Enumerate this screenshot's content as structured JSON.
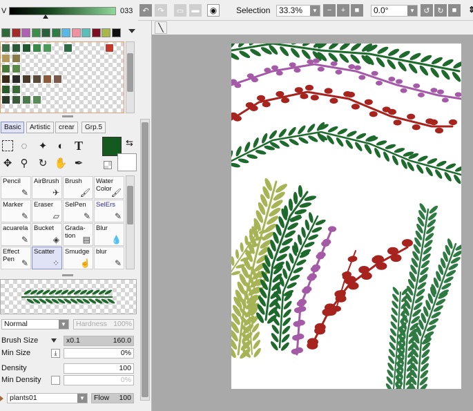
{
  "color_slider": {
    "channel": "V",
    "value": "033"
  },
  "palette_row": [
    "#2c6a3a",
    "#a52a2a",
    "#b060b0",
    "#3e8c4c",
    "#2b5e3e",
    "#2e7d46",
    "#58b8e8",
    "#f090a0",
    "#58c0b8",
    "#7a1020",
    "#a8b848",
    "#101010"
  ],
  "tabs": [
    "Basic",
    "Artistic",
    "crear",
    "Grp.5"
  ],
  "main_color": "#145a1e",
  "brushes": [
    {
      "label": "Pencil",
      "icon": "✎"
    },
    {
      "label": "AirBrush",
      "icon": "✈"
    },
    {
      "label": "Brush",
      "icon": "🖌"
    },
    {
      "label": "Water Color",
      "icon": "🖌"
    },
    {
      "label": "Marker",
      "icon": "✎"
    },
    {
      "label": "Eraser",
      "icon": "▱"
    },
    {
      "label": "SelPen",
      "icon": "✎"
    },
    {
      "label": "SelErs",
      "icon": "✎"
    },
    {
      "label": "acuarela",
      "icon": "✎"
    },
    {
      "label": "Bucket",
      "icon": "◈"
    },
    {
      "label": "Grada-tion",
      "icon": "▤"
    },
    {
      "label": "Blur",
      "icon": "💧"
    },
    {
      "label": "Effect Pen",
      "icon": "✎"
    },
    {
      "label": "Scatter",
      "icon": "⁘"
    },
    {
      "label": "Smudge",
      "icon": "☝"
    },
    {
      "label": "blur",
      "icon": "✎"
    }
  ],
  "blend_mode": "Normal",
  "hardness": {
    "label": "Hardness",
    "value": "100%"
  },
  "brush_size": {
    "label": "Brush Size",
    "multiplier": "x0.1",
    "value": "160.0"
  },
  "min_size": {
    "label": "Min Size",
    "value": "0%"
  },
  "density": {
    "label": "Density",
    "value": "100"
  },
  "min_density": {
    "label": "Min Density",
    "value": "0%"
  },
  "texture": {
    "name": "plants01",
    "flow_label": "Flow",
    "flow_value": "100"
  },
  "toolbar": {
    "selection_label": "Selection",
    "zoom": "33.3%",
    "rotation": "0.0°"
  },
  "colors": {
    "dark_green": "#1d6a2c",
    "green": "#2f7a43",
    "olive": "#a7b456",
    "purple": "#a45aa7",
    "red": "#a6231e"
  }
}
